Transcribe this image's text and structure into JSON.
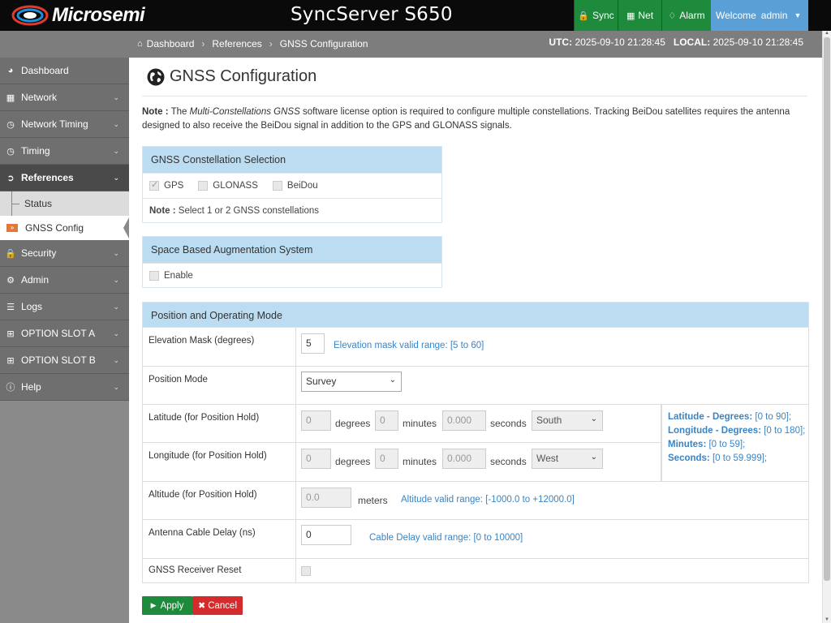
{
  "header": {
    "brand": "Microsemi",
    "app_title": "SyncServer S650",
    "status": {
      "sync": "Sync",
      "net": "Net",
      "alarm": "Alarm"
    },
    "welcome_label": "Welcome",
    "user": "admin",
    "colors": {
      "status_ok": "#1e8a3c",
      "welcome_bg": "#5aa0d6"
    }
  },
  "breadcrumb": {
    "items": [
      "Dashboard",
      "References",
      "GNSS Configuration"
    ]
  },
  "clock": {
    "utc_label": "UTC:",
    "utc_value": "2025-09-10 21:28:45",
    "local_label": "LOCAL:",
    "local_value": "2025-09-10 21:28:45"
  },
  "sidebar": {
    "items": [
      {
        "label": "Dashboard",
        "icon": "dashboard-icon"
      },
      {
        "label": "Network",
        "icon": "sitemap-icon"
      },
      {
        "label": "Network Timing",
        "icon": "clock-icon"
      },
      {
        "label": "Timing",
        "icon": "clock-icon"
      },
      {
        "label": "References",
        "icon": "sign-in-icon"
      },
      {
        "label": "Security",
        "icon": "lock-icon"
      },
      {
        "label": "Admin",
        "icon": "gear-icon"
      },
      {
        "label": "Logs",
        "icon": "list-icon"
      },
      {
        "label": "OPTION SLOT A",
        "icon": "plus-square-icon"
      },
      {
        "label": "OPTION SLOT B",
        "icon": "plus-square-icon"
      },
      {
        "label": "Help",
        "icon": "info-icon"
      }
    ],
    "sub_items": [
      "Status",
      "GNSS Config"
    ]
  },
  "page": {
    "title": "GNSS Configuration",
    "note_label": "Note :",
    "note_pre": "The",
    "note_emph": "Multi-Constellations GNSS",
    "note_post": "software license option is required to configure multiple constellations. Tracking BeiDou satellites requires the antenna designed to also receive the BeiDou signal in addition to the GPS and GLONASS signals."
  },
  "constellation": {
    "heading": "GNSS Constellation Selection",
    "options": [
      {
        "label": "GPS",
        "checked": true
      },
      {
        "label": "GLONASS",
        "checked": false
      },
      {
        "label": "BeiDou",
        "checked": false
      }
    ],
    "note_label": "Note :",
    "note_text": "Select 1 or 2 GNSS constellations"
  },
  "sbas": {
    "heading": "Space Based Augmentation System",
    "enable_label": "Enable",
    "enabled": false
  },
  "position": {
    "heading": "Position and Operating Mode",
    "elevation_label": "Elevation Mask (degrees)",
    "elevation_value": "5",
    "elevation_hint": "Elevation mask valid range: [5 to 60]",
    "mode_label": "Position Mode",
    "mode_value": "Survey",
    "lat_label": "Latitude (for Position Hold)",
    "lat_deg": "0",
    "lat_min": "0",
    "lat_sec": "0.000",
    "lat_dir": "South",
    "lon_label": "Longitude (for Position Hold)",
    "lon_deg": "0",
    "lon_min": "0",
    "lon_sec": "0.000",
    "lon_dir": "West",
    "unit_degrees": "degrees",
    "unit_minutes": "minutes",
    "unit_seconds": "seconds",
    "alt_label": "Altitude (for Position Hold)",
    "alt_value": "0.0",
    "alt_unit": "meters",
    "alt_hint": "Altitude valid range: [-1000.0 to +12000.0]",
    "cable_label": "Antenna Cable Delay (ns)",
    "cable_value": "0",
    "cable_hint": "Cable Delay valid range: [0 to 10000]",
    "reset_label": "GNSS Receiver Reset",
    "reset_checked": false,
    "ranges": {
      "lat_deg_label": "Latitude - Degrees:",
      "lat_deg_range": "[0 to 90];",
      "lon_deg_label": "Longitude - Degrees:",
      "lon_deg_range": "[0 to 180];",
      "min_label": "Minutes:",
      "min_range": "[0 to 59];",
      "sec_label": "Seconds:",
      "sec_range": "[0 to 59.999];"
    }
  },
  "buttons": {
    "apply": "Apply",
    "cancel": "Cancel"
  }
}
